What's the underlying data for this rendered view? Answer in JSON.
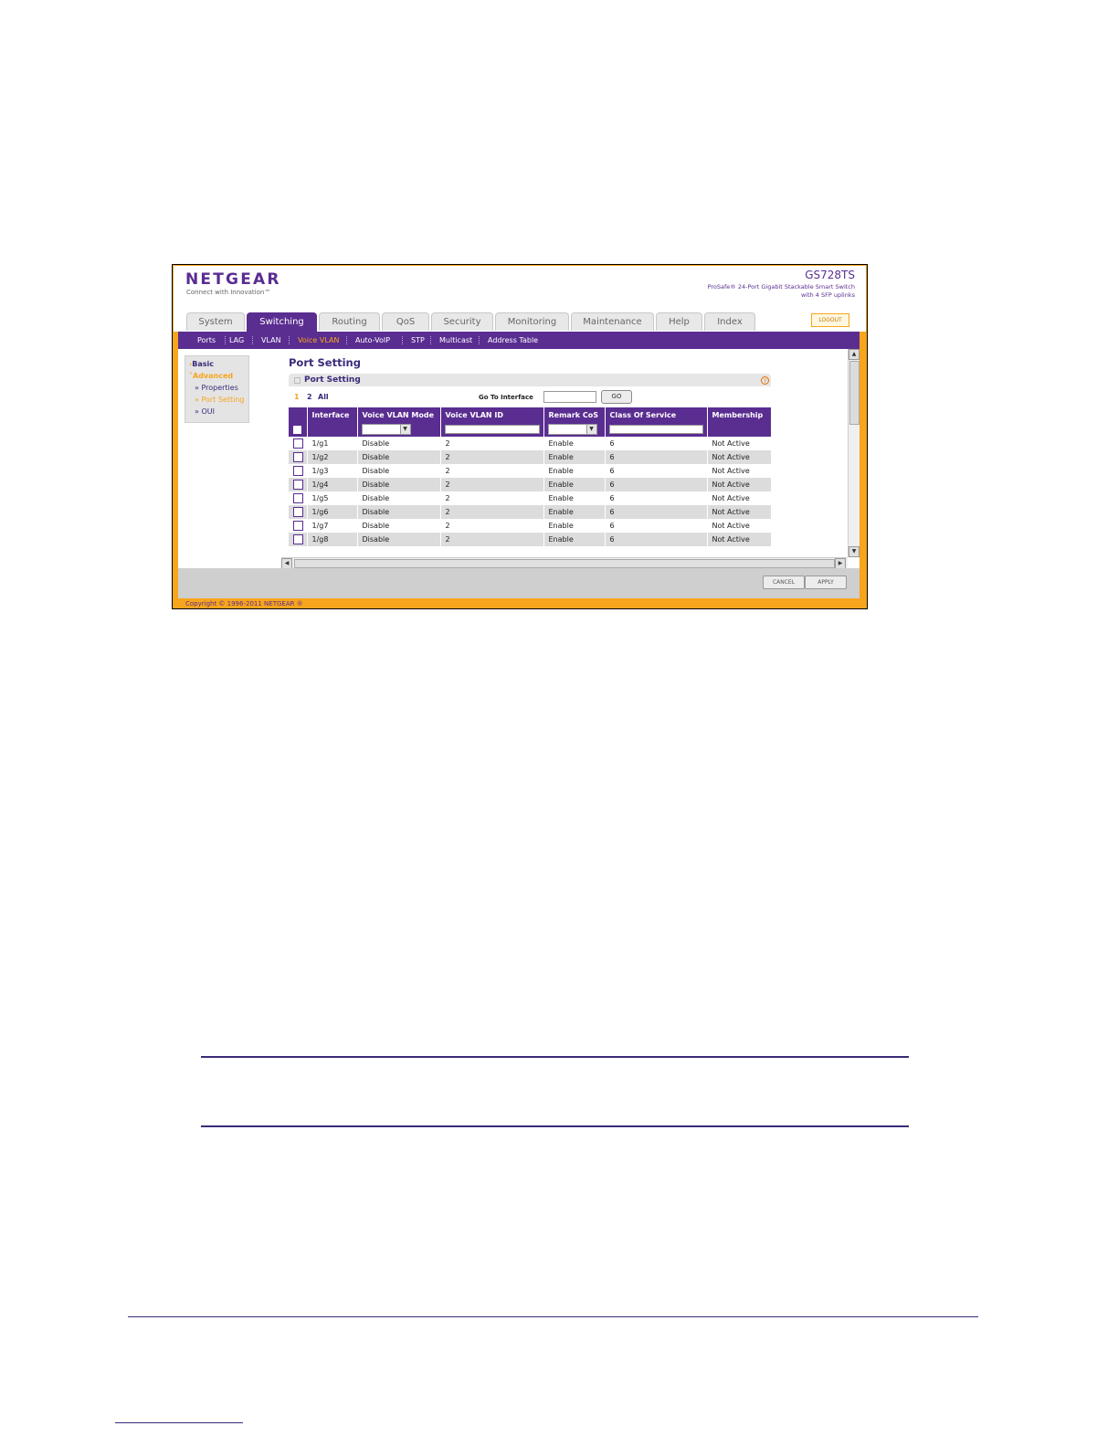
{
  "header": {
    "logo": "NETGEAR",
    "tagline": "Connect with Innovation™",
    "model": "GS728TS",
    "description_line1": "ProSafe® 24-Port Gigabit Stackable Smart Switch",
    "description_line2": "with 4 SFP uplinks",
    "logout": "LOGOUT"
  },
  "tabs": [
    "System",
    "Switching",
    "Routing",
    "QoS",
    "Security",
    "Monitoring",
    "Maintenance",
    "Help",
    "Index"
  ],
  "active_tab": "Switching",
  "subnav": [
    "Ports",
    "LAG",
    "VLAN",
    "Voice VLAN",
    "Auto-VoIP",
    "STP",
    "Multicast",
    "Address Table"
  ],
  "active_subnav": "Voice VLAN",
  "leftmenu": {
    "basic": "Basic",
    "advanced": "Advanced",
    "properties": "Properties",
    "port_setting": "Port Setting",
    "oui": "OUI"
  },
  "page_title": "Port Setting",
  "panel": {
    "title": "Port Setting",
    "help": "?",
    "pages": [
      "1",
      "2",
      "All"
    ],
    "goto_label": "Go To Interface",
    "go_button": "GO"
  },
  "table": {
    "headers": [
      "Interface",
      "Voice VLAN Mode",
      "Voice VLAN ID",
      "Remark CoS",
      "Class Of Service",
      "Membership"
    ],
    "rows": [
      [
        "1/g1",
        "Disable",
        "2",
        "Enable",
        "6",
        "Not Active"
      ],
      [
        "1/g2",
        "Disable",
        "2",
        "Enable",
        "6",
        "Not Active"
      ],
      [
        "1/g3",
        "Disable",
        "2",
        "Enable",
        "6",
        "Not Active"
      ],
      [
        "1/g4",
        "Disable",
        "2",
        "Enable",
        "6",
        "Not Active"
      ],
      [
        "1/g5",
        "Disable",
        "2",
        "Enable",
        "6",
        "Not Active"
      ],
      [
        "1/g6",
        "Disable",
        "2",
        "Enable",
        "6",
        "Not Active"
      ],
      [
        "1/g7",
        "Disable",
        "2",
        "Enable",
        "6",
        "Not Active"
      ],
      [
        "1/g8",
        "Disable",
        "2",
        "Enable",
        "6",
        "Not Active"
      ]
    ]
  },
  "buttons": {
    "cancel": "CANCEL",
    "apply": "APPLY"
  },
  "copyright": "Copyright © 1996-2011 NETGEAR ®",
  "colors": {
    "brand_purple": "#5a2d91",
    "brand_orange": "#f7a51c"
  }
}
